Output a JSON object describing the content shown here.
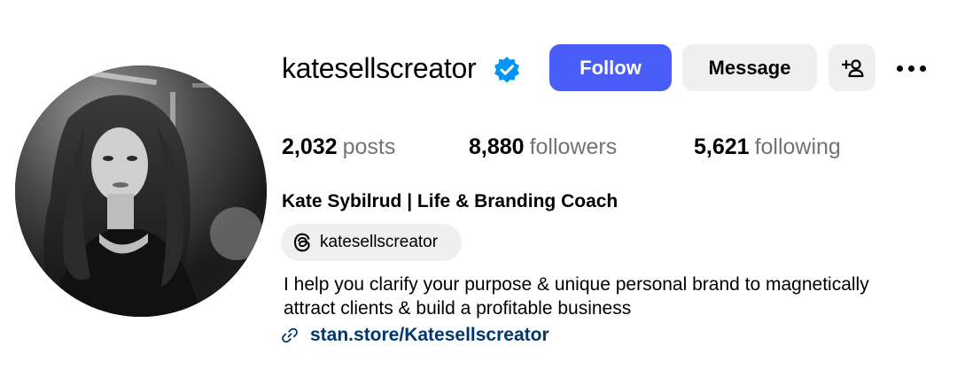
{
  "profile": {
    "username": "katesellscreator",
    "verified": true,
    "full_name": "Kate Sybilrud | Life & Branding Coach",
    "threads_handle": "katesellscreator",
    "bio_lines": [
      "I help you clarify your purpose & unique personal brand to magnetically",
      "attract clients & build a profitable business"
    ],
    "link": "stan.store/Katesellscreator"
  },
  "actions": {
    "follow_label": "Follow",
    "message_label": "Message"
  },
  "stats": {
    "posts": {
      "count": "2,032",
      "label": "posts"
    },
    "followers": {
      "count": "8,880",
      "label": "followers"
    },
    "following": {
      "count": "5,621",
      "label": "following"
    }
  },
  "icons": {
    "verified": "verified-badge-icon",
    "add_user": "add-user-icon",
    "more": "more-options-icon",
    "threads": "threads-icon",
    "link": "link-icon"
  },
  "colors": {
    "follow_button": "#4a5df9",
    "secondary_button": "#efefef",
    "verified": "#0095f6",
    "link": "#00376b",
    "muted_text": "#737373"
  }
}
